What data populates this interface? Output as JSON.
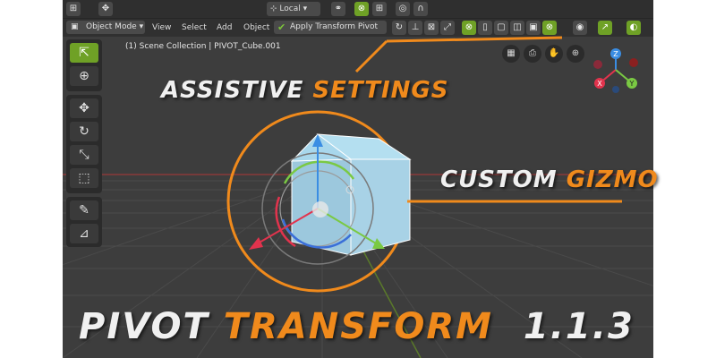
{
  "header": {
    "orientation_label": "Local",
    "mode_label": "Object Mode",
    "menu": [
      "View",
      "Select",
      "Add",
      "Object"
    ],
    "apply_label": "Apply Transform Pivot"
  },
  "breadcrumb": "(1) Scene Collection | PIVOT_Cube.001",
  "object_label": "PIVOT_Cube.001",
  "gizmo_axes": {
    "z": "Z",
    "x": "X",
    "y": "Y"
  },
  "callouts": {
    "assistive_1": "ASSISTIVE",
    "assistive_2": "SETTINGS",
    "custom_1": "CUSTOM",
    "custom_2": "GIZMO"
  },
  "title": {
    "word1": "PIVOT",
    "word2": "TRANSFORM",
    "version": "1.1.3"
  },
  "colors": {
    "accent": "#f08a1c",
    "active_tool": "#6fa126",
    "axis_x": "#e2334d",
    "axis_y": "#7ac943",
    "axis_z": "#3a8de3"
  },
  "icons": {
    "tools": [
      "cursor-select-icon",
      "3d-cursor-icon",
      "move-icon",
      "rotate-icon",
      "scale-icon",
      "transform-icon",
      "annotate-icon",
      "measure-icon"
    ],
    "nav": [
      "perspective-grid-icon",
      "camera-icon",
      "hand-pan-icon",
      "zoom-icon"
    ]
  }
}
